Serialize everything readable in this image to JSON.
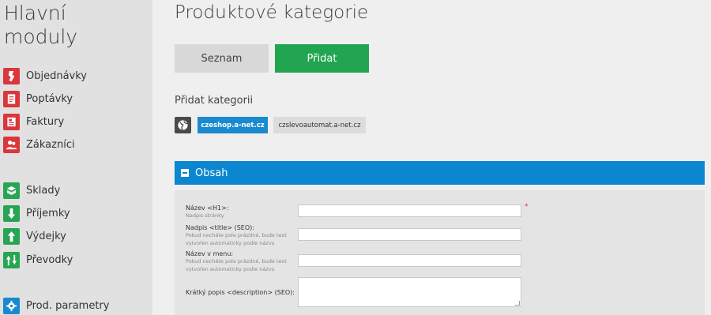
{
  "sidebar": {
    "title_line1": "Hlavní",
    "title_line2": "moduly",
    "items": [
      {
        "label": "Objednávky",
        "icon": "order-icon",
        "color": "#d9373b"
      },
      {
        "label": "Poptávky",
        "icon": "inquiry-icon",
        "color": "#d9373b"
      },
      {
        "label": "Faktury",
        "icon": "invoice-icon",
        "color": "#d9373b"
      },
      {
        "label": "Zákazníci",
        "icon": "customers-icon",
        "color": "#d9373b"
      },
      {
        "label": "Sklady",
        "icon": "warehouse-icon",
        "color": "#26a552"
      },
      {
        "label": "Příjemky",
        "icon": "arrow-down-icon",
        "color": "#26a552"
      },
      {
        "label": "Výdejky",
        "icon": "arrow-up-icon",
        "color": "#26a552"
      },
      {
        "label": "Převodky",
        "icon": "transfer-icon",
        "color": "#26a552"
      },
      {
        "label": "Prod. parametry",
        "icon": "gear-icon",
        "color": "#1a8ad0"
      }
    ]
  },
  "main": {
    "title": "Produktové kategorie",
    "buttons": {
      "list_label": "Seznam",
      "add_label": "Přidat"
    },
    "subtitle": "Přidat kategorii",
    "shops": {
      "icon": "globe-icon",
      "tabs": [
        {
          "label": "czeshop.a-net.cz",
          "active": true
        },
        {
          "label": "czslevoautomat.a-net.cz",
          "active": false
        }
      ]
    },
    "section": {
      "title": "Obsah",
      "color": "#0b86cf"
    },
    "form": {
      "name_label": "Název <H1>:",
      "name_hint": "Nadpis stránky",
      "name_value": "",
      "name_required": "*",
      "title_label": "Nadpis <title> (SEO):",
      "title_hint": "Pokud necháte pole prázdné, bude text vytvořen automaticky podle názvu",
      "title_value": "",
      "menu_label": "Název v menu:",
      "menu_hint": "Pokud necháte pole prázdné, bude text vytvořen automaticky podle názvu",
      "menu_value": "",
      "description_label": "Krátký popis <description> (SEO):",
      "description_value": ""
    }
  }
}
